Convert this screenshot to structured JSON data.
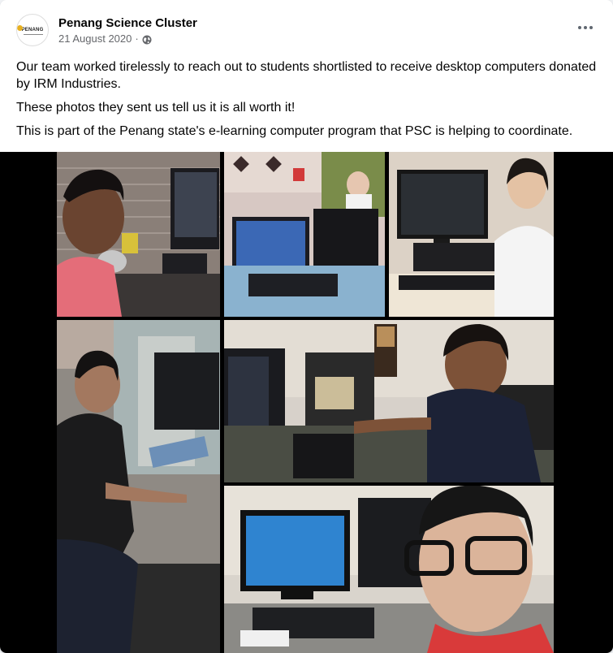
{
  "post": {
    "page_name": "Penang Science Cluster",
    "date": "21 August 2020",
    "separator": "·",
    "avatar_logo_text": "PENANG",
    "privacy_icon": "globe-icon",
    "menu_icon": "more-options-icon",
    "paragraphs": [
      "Our team worked tirelessly to reach out to students shortlisted to receive desktop computers donated by IRM Industries.",
      "These photos they sent us tell us it is all worth it!",
      "This is part of the Penang state's e-learning computer program that PSC is helping to coordinate."
    ]
  },
  "colors": {
    "name": "#050505",
    "secondary": "#65676b",
    "media_background": "#000000"
  }
}
